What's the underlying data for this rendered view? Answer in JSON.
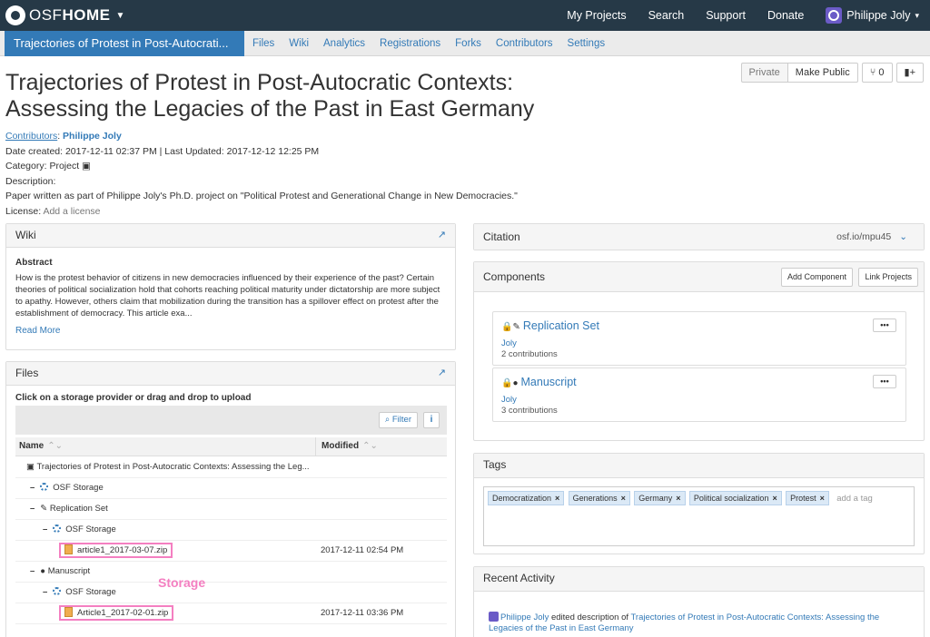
{
  "navbar": {
    "brand_light": "OSF",
    "brand_bold": "HOME",
    "links": [
      "My Projects",
      "Search",
      "Support"
    ],
    "donate": "Donate",
    "user": "Philippe Joly"
  },
  "project_nav": {
    "title": "Trajectories of Protest in Post-Autocrati...",
    "links": [
      "Files",
      "Wiki",
      "Analytics",
      "Registrations",
      "Forks",
      "Contributors",
      "Settings"
    ]
  },
  "privacy": {
    "private": "Private",
    "make_public": "Make Public",
    "forks_count": "0"
  },
  "project": {
    "title": "Trajectories of Protest in Post-Autocratic Contexts: Assessing the Legacies of the Past in East Germany",
    "contributors_label": "Contributors",
    "contributor": "Philippe Joly",
    "dates": "Date created: 2017-12-11 02:37 PM | Last Updated: 2017-12-12 12:25 PM",
    "category": "Category: Project",
    "description_label": "Description:",
    "description": "Paper written as part of Philippe Joly's Ph.D. project on \"Political Protest and Generational Change in New Democracies.\"",
    "license_label": "License:",
    "license_value": "Add a license"
  },
  "wiki": {
    "heading": "Wiki",
    "subheading": "Abstract",
    "text": "How is the protest behavior of citizens in new democracies influenced by their experience of the past? Certain theories of political socialization hold that cohorts reaching political maturity under dictatorship are more subject to apathy. However, others claim that mobilization during the transition has a spillover effect on protest after the establishment of democracy. This article exa...",
    "read_more": "Read More"
  },
  "files": {
    "heading": "Files",
    "hint": "Click on a storage provider or drag and drop to upload",
    "filter": "Filter",
    "info": "i",
    "col_name": "Name",
    "col_modified": "Modified",
    "rows": [
      {
        "label": "Trajectories of Protest in Post-Autocratic Contexts: Assessing the Leg...",
        "modified": ""
      },
      {
        "label": "OSF Storage",
        "modified": ""
      },
      {
        "label": "Replication Set",
        "modified": ""
      },
      {
        "label": "OSF Storage",
        "modified": ""
      },
      {
        "label": "article1_2017-03-07.zip",
        "modified": "2017-12-11 02:54 PM"
      },
      {
        "label": "Manuscript",
        "modified": ""
      },
      {
        "label": "OSF Storage",
        "modified": ""
      },
      {
        "label": "Article1_2017-02-01.zip",
        "modified": "2017-12-11 03:36 PM"
      }
    ],
    "annotation": "Storage"
  },
  "citation": {
    "heading": "Citation",
    "link": "osf.io/mpu45"
  },
  "components": {
    "heading": "Components",
    "add_button": "Add Component",
    "link_button": "Link Projects",
    "items": [
      {
        "title": "Replication Set",
        "user": "Joly",
        "count": "2 contributions"
      },
      {
        "title": "Manuscript",
        "user": "Joly",
        "count": "3 contributions"
      }
    ]
  },
  "tags": {
    "heading": "Tags",
    "items": [
      "Democratization",
      "Generations",
      "Germany",
      "Political socialization",
      "Protest"
    ],
    "placeholder": "add a tag"
  },
  "recent": {
    "heading": "Recent Activity",
    "user": "Philippe Joly",
    "action": "edited description of",
    "target": "Trajectories of Protest in Post-Autocratic Contexts: Assessing the Legacies of the Past in East Germany"
  },
  "colors": {
    "navbar": "#263947",
    "accent": "#337ab7",
    "donate": "#5cb85c",
    "annotation": "#f47fc1"
  }
}
